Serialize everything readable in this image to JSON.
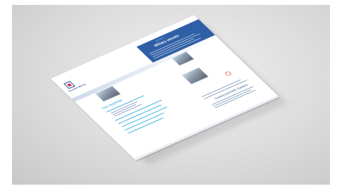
{
  "flyer": {
    "brand": "Fountnet Marine",
    "section_label": "SERVICE",
    "title": "Military vessels",
    "expertise_heading": "Our expertise",
    "footer_heading": "Cooling and HVAC Systems"
  },
  "colors": {
    "background": "#d6d6d6",
    "header_panel": "#2f5fa6",
    "accent_cyan": "#1fa6d8",
    "brand_text": "#2a4a86"
  }
}
